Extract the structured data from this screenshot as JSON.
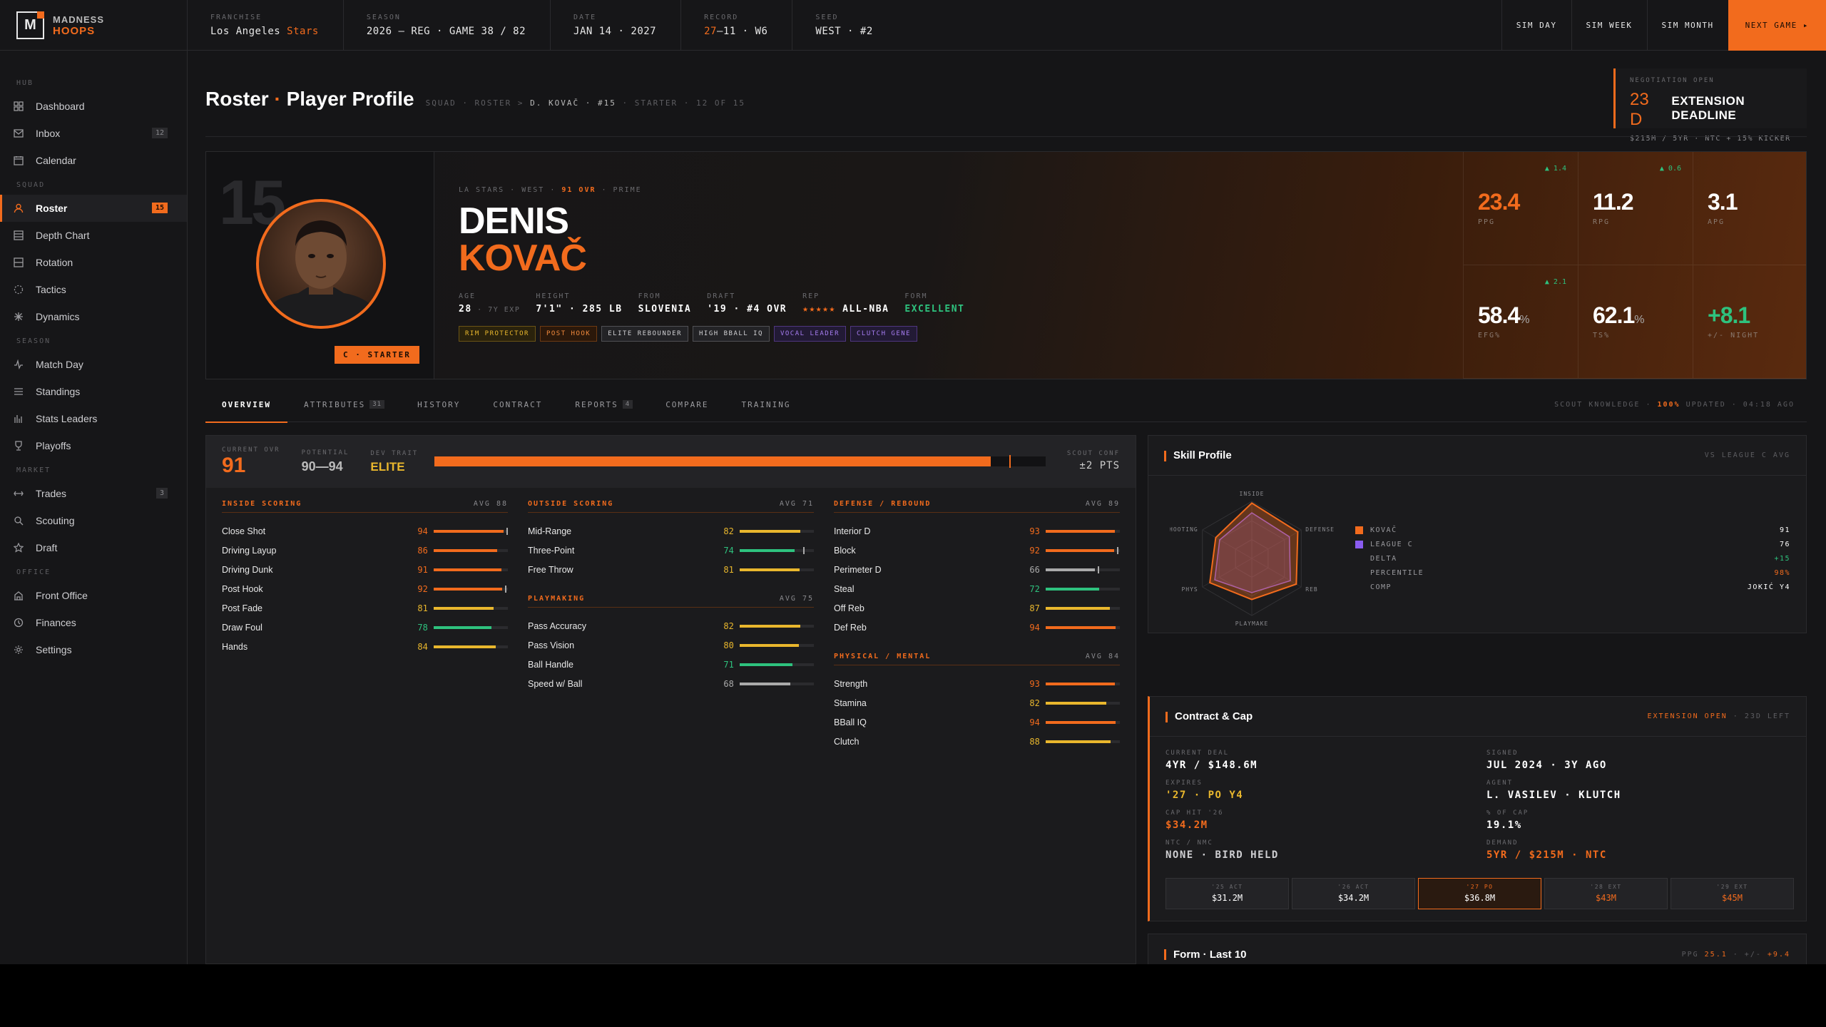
{
  "brand": {
    "line1": "MADNESS",
    "line2": "HOOPS",
    "logo": "M"
  },
  "topbar": {
    "info": [
      {
        "label": "FRANCHISE",
        "value": "Los Angeles ",
        "accent": "Stars"
      },
      {
        "label": "SEASON",
        "value": "2026 — REG · GAME 38 / 82",
        "accent": ""
      },
      {
        "label": "DATE",
        "value": "JAN 14 · 2027",
        "accent": ""
      },
      {
        "label": "RECORD",
        "value": "—11 · W6",
        "accent": "27"
      },
      {
        "label": "SEED",
        "value": "WEST · #2",
        "accent": ""
      }
    ],
    "sim_day": "SIM DAY",
    "sim_week": "SIM WEEK",
    "sim_month": "SIM MONTH",
    "next_game": "NEXT GAME ▸"
  },
  "sidebar": {
    "sections": [
      "HUB",
      "SQUAD",
      "SEASON",
      "MARKET",
      "OFFICE"
    ],
    "items": [
      {
        "label": "Dashboard",
        "icon": "grid-icon"
      },
      {
        "label": "Inbox",
        "icon": "inbox-icon",
        "badge": "12"
      },
      {
        "label": "Calendar",
        "icon": "calendar-icon"
      },
      {
        "label": "Roster",
        "icon": "person-icon",
        "badge": "15"
      },
      {
        "label": "Depth Chart",
        "icon": "layers-icon"
      },
      {
        "label": "Rotation",
        "icon": "rotation-icon"
      },
      {
        "label": "Tactics",
        "icon": "tactics-icon"
      },
      {
        "label": "Dynamics",
        "icon": "dynamics-icon"
      },
      {
        "label": "Match Day",
        "icon": "pulse-icon"
      },
      {
        "label": "Standings",
        "icon": "list-icon"
      },
      {
        "label": "Stats Leaders",
        "icon": "bars-icon"
      },
      {
        "label": "Playoffs",
        "icon": "trophy-icon"
      },
      {
        "label": "Trades",
        "icon": "swap-icon",
        "badge": "3"
      },
      {
        "label": "Scouting",
        "icon": "search-icon"
      },
      {
        "label": "Draft",
        "icon": "star-icon"
      },
      {
        "label": "Front Office",
        "icon": "building-icon"
      },
      {
        "label": "Finances",
        "icon": "clock-icon"
      },
      {
        "label": "Settings",
        "icon": "gear-icon"
      }
    ]
  },
  "page": {
    "title": "Roster",
    "title_dot": "·",
    "title2": "Player Profile",
    "crumbs_pre": "SQUAD · ROSTER > ",
    "crumbs_bold": "D. KOVAČ · #15",
    "crumbs_post": " · STARTER · 12 OF 15"
  },
  "deadline": {
    "label": "NEGOTIATION OPEN",
    "days": "23 D",
    "title": "EXTENSION DEADLINE",
    "sub": "$215M / 5YR · NTC + 15% KICKER"
  },
  "player": {
    "jersey": "15",
    "position": "C · STARTER",
    "kicker_pre": "LA STARS · WEST · ",
    "kicker_ovr": "91 OVR",
    "kicker_post": " · PRIME",
    "first": "DENIS",
    "last": "KOVAČ",
    "facts": {
      "age_l": "AGE",
      "age_v": "28",
      "age_s": " · 7Y EXP",
      "height_l": "HEIGHT",
      "height_v": "7'1\" · 285 LB",
      "from_l": "FROM",
      "from_v": "SLOVENIA",
      "draft_l": "DRAFT",
      "draft_v": "'19 · #4 OVR",
      "rep_l": "REP",
      "rep_stars": "★★★★★",
      "rep_v": " ALL-NBA",
      "form_l": "FORM",
      "form_v": "EXCELLENT"
    },
    "tags": [
      {
        "label": "RIM PROTECTOR",
        "tone": "y"
      },
      {
        "label": "POST HOOK",
        "tone": "o"
      },
      {
        "label": "ELITE REBOUNDER",
        "tone": "g"
      },
      {
        "label": "HIGH BBALL IQ",
        "tone": "g"
      },
      {
        "label": "VOCAL LEADER",
        "tone": "p"
      },
      {
        "label": "CLUTCH GENE",
        "tone": "p"
      }
    ],
    "stats": [
      {
        "value": "23.4",
        "unit": "",
        "label": "PPG",
        "trend": "▲ 1.4",
        "tone": "or"
      },
      {
        "value": "11.2",
        "unit": "",
        "label": "RPG",
        "trend": "▲ 0.6",
        "tone": ""
      },
      {
        "value": "3.1",
        "unit": "",
        "label": "APG",
        "trend": "",
        "tone": ""
      },
      {
        "value": "58.4",
        "unit": "%",
        "label": "EFG%",
        "trend": "▲ 2.1",
        "tone": ""
      },
      {
        "value": "62.1",
        "unit": "%",
        "label": "TS%",
        "trend": "",
        "tone": ""
      },
      {
        "value": "+8.1",
        "unit": "",
        "label": "+/- NIGHT",
        "trend": "",
        "tone": "gr"
      }
    ]
  },
  "tabs": [
    {
      "label": "OVERVIEW",
      "badge": ""
    },
    {
      "label": "ATTRIBUTES",
      "badge": "31"
    },
    {
      "label": "HISTORY",
      "badge": ""
    },
    {
      "label": "CONTRACT",
      "badge": ""
    },
    {
      "label": "REPORTS",
      "badge": "4"
    },
    {
      "label": "COMPARE",
      "badge": ""
    },
    {
      "label": "TRAINING",
      "badge": ""
    }
  ],
  "scout": {
    "pre": "SCOUT KNOWLEDGE · ",
    "pct": "100%",
    "post": " UPDATED · 04:18 AGO"
  },
  "ovr": {
    "cur_l": "CURRENT OVR",
    "cur_v": "91",
    "pot_l": "POTENTIAL",
    "pot_v": "90—94",
    "dev_l": "DEV TRAIT",
    "dev_v": "ELITE",
    "fill": 0.91,
    "marker": 0.94,
    "conf_l": "SCOUT CONF",
    "conf_v": "±2 PTS"
  },
  "attributes": [
    [
      {
        "name": "INSIDE SCORING",
        "avg": "AVG 88",
        "items": [
          {
            "n": "Close Shot",
            "v": 94,
            "c": "#f26b1d",
            "m": 0.98
          },
          {
            "n": "Driving Layup",
            "v": 86,
            "c": "#f26b1d",
            "m": 0
          },
          {
            "n": "Driving Dunk",
            "v": 91,
            "c": "#f26b1d",
            "m": 0
          },
          {
            "n": "Post Hook",
            "v": 92,
            "c": "#f26b1d",
            "m": 0.96
          },
          {
            "n": "Post Fade",
            "v": 81,
            "c": "#e9b72d",
            "m": 0
          },
          {
            "n": "Draw Foul",
            "v": 78,
            "c": "#2ec27e",
            "m": 0
          },
          {
            "n": "Hands",
            "v": 84,
            "c": "#e9b72d",
            "m": 0
          }
        ]
      }
    ],
    [
      {
        "name": "OUTSIDE SCORING",
        "avg": "AVG 71",
        "items": [
          {
            "n": "Mid-Range",
            "v": 82,
            "c": "#e9b72d",
            "m": 0
          },
          {
            "n": "Three-Point",
            "v": 74,
            "c": "#2ec27e",
            "m": 0.86
          },
          {
            "n": "Free Throw",
            "v": 81,
            "c": "#e9b72d",
            "m": 0
          }
        ]
      },
      {
        "name": "PLAYMAKING",
        "avg": "AVG 75",
        "items": [
          {
            "n": "Pass Accuracy",
            "v": 82,
            "c": "#e9b72d",
            "m": 0
          },
          {
            "n": "Pass Vision",
            "v": 80,
            "c": "#e9b72d",
            "m": 0
          },
          {
            "n": "Ball Handle",
            "v": 71,
            "c": "#2ec27e",
            "m": 0
          },
          {
            "n": "Speed w/ Ball",
            "v": 68,
            "c": "#aaaaaa",
            "m": 0
          }
        ]
      }
    ],
    [
      {
        "name": "DEFENSE / REBOUND",
        "avg": "AVG 89",
        "items": [
          {
            "n": "Interior D",
            "v": 93,
            "c": "#f26b1d",
            "m": 0
          },
          {
            "n": "Block",
            "v": 92,
            "c": "#f26b1d",
            "m": 0.96
          },
          {
            "n": "Perimeter D",
            "v": 66,
            "c": "#aaaaaa",
            "m": 0.7
          },
          {
            "n": "Steal",
            "v": 72,
            "c": "#2ec27e",
            "m": 0
          },
          {
            "n": "Off Reb",
            "v": 87,
            "c": "#e9b72d",
            "m": 0
          },
          {
            "n": "Def Reb",
            "v": 94,
            "c": "#f26b1d",
            "m": 0
          }
        ]
      },
      {
        "name": "PHYSICAL / MENTAL",
        "avg": "AVG 84",
        "items": [
          {
            "n": "Strength",
            "v": 93,
            "c": "#f26b1d",
            "m": 0
          },
          {
            "n": "Stamina",
            "v": 82,
            "c": "#e9b72d",
            "m": 0
          },
          {
            "n": "BBall IQ",
            "v": 94,
            "c": "#f26b1d",
            "m": 0
          },
          {
            "n": "Clutch",
            "v": 88,
            "c": "#e9b72d",
            "m": 0
          }
        ]
      }
    ]
  ],
  "skill": {
    "title": "Skill Profile",
    "right": "VS LEAGUE C AVG",
    "axes": [
      "INSIDE",
      "DEFENSE",
      "REB",
      "PLAYMAKE",
      "PHYS",
      "SHOOTING"
    ],
    "player": [
      0.97,
      0.93,
      0.9,
      0.72,
      0.85,
      0.73
    ],
    "league": [
      0.8,
      0.76,
      0.78,
      0.6,
      0.75,
      0.65
    ],
    "legend": [
      {
        "label": "KOVAČ",
        "value": "91",
        "sw": "#f26b1d",
        "tone": ""
      },
      {
        "label": "LEAGUE C",
        "value": "76",
        "sw": "#8a5cf0",
        "tone": ""
      },
      {
        "label": "DELTA",
        "value": "+15",
        "sw": "",
        "tone": "g"
      },
      {
        "label": "PERCENTILE",
        "value": "98%",
        "sw": "",
        "tone": "o"
      },
      {
        "label": "COMP",
        "value": "JOKIĆ Y4",
        "sw": "",
        "tone": ""
      }
    ]
  },
  "contract": {
    "title": "Contract & Cap",
    "right_acc": "EXTENSION OPEN",
    "right_rest": " · 23D LEFT",
    "fields": [
      {
        "l": "CURRENT DEAL",
        "v": "4YR / $148.6M",
        "tone": ""
      },
      {
        "l": "SIGNED",
        "v": "JUL 2024 · 3Y AGO",
        "tone": ""
      },
      {
        "l": "EXPIRES",
        "v": "'27 · PO Y4",
        "tone": "y"
      },
      {
        "l": "AGENT",
        "v": "L. VASILEV · KLUTCH",
        "tone": ""
      },
      {
        "l": "CAP HIT '26",
        "v": "$34.2M",
        "tone": "o"
      },
      {
        "l": "% OF CAP",
        "v": "19.1%",
        "tone": ""
      },
      {
        "l": "NTC / NMC",
        "v": "NONE · BIRD HELD",
        "tone": "g"
      },
      {
        "l": "DEMAND",
        "v": "5YR / $215M · NTC",
        "tone": "o"
      }
    ],
    "years": [
      {
        "l": "'25 ACT",
        "v": "$31.2M",
        "kind": ""
      },
      {
        "l": "'26 ACT",
        "v": "$34.2M",
        "kind": ""
      },
      {
        "l": "'27 PO",
        "v": "$36.8M",
        "kind": "cur"
      },
      {
        "l": "'28 EXT",
        "v": "$43M",
        "kind": "ext"
      },
      {
        "l": "'29 EXT",
        "v": "$45M",
        "kind": "ext"
      }
    ]
  },
  "form": {
    "title": "Form · Last 10",
    "r1": "PPG ",
    "r2": "25.1",
    "r3": " · +/- ",
    "r4": "+9.4"
  }
}
